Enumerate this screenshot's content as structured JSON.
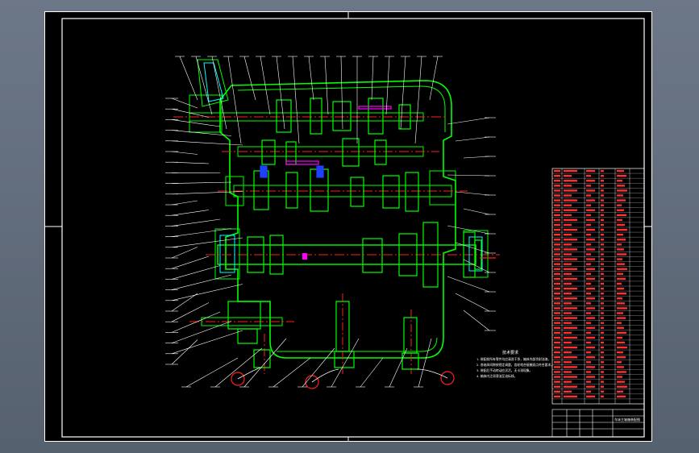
{
  "drawing": {
    "background": "#000000",
    "colors": {
      "border": "#ffffff",
      "outline": "#00ff00",
      "centerline": "#ff2020",
      "leader": "#ffffff",
      "accent": "#00ffff",
      "blue": "#2040ff",
      "magenta": "#ff00ff",
      "bom_text": "#ff3030"
    },
    "notes_title": "技术要求",
    "notes": [
      "1. 装配前所有零件均应清洗干净，箱体内部涂耐油漆。",
      "2. 各轴承间隙按规定调整，齿轮啮合接触斑点符合要求。",
      "3. 装配后手动转动应灵活，无卡滞现象。",
      "4. 箱体内注润滑油至油标线。"
    ],
    "title_block_title": "车床主轴箱装配图",
    "balloon_count_left": 26,
    "balloon_count_top": 17,
    "balloon_count_right": 12,
    "balloon_count_bottom": 9
  }
}
